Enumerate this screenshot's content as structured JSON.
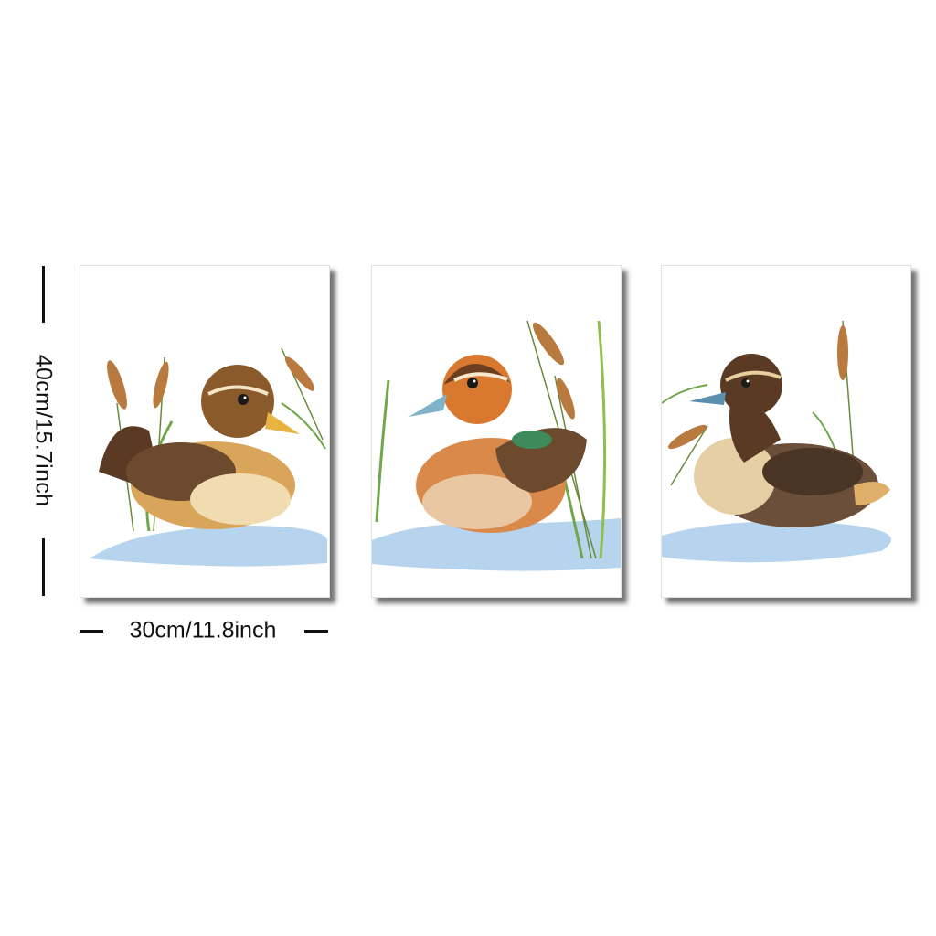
{
  "dimensions": {
    "height_label": "40cm/15.7inch",
    "width_label": "30cm/11.8inch"
  },
  "panels": [
    {
      "subject": "duckling-with-cattails",
      "body_color": "#b8894a",
      "head_color": "#8a5a2b",
      "bill_color": "#e8b340"
    },
    {
      "subject": "duck-with-blue-bill",
      "body_color": "#d98a4a",
      "head_color": "#7a4a25",
      "bill_color": "#7fb3c9"
    },
    {
      "subject": "brown-duck-with-cattails",
      "body_color": "#6b4f3a",
      "head_color": "#5a3a22",
      "bill_color": "#5a8fb0"
    }
  ],
  "colors": {
    "water": "#a9cdea",
    "cattail": "#b87a3e",
    "reed": "#6fa84a",
    "frame_shadow": "#333333"
  }
}
